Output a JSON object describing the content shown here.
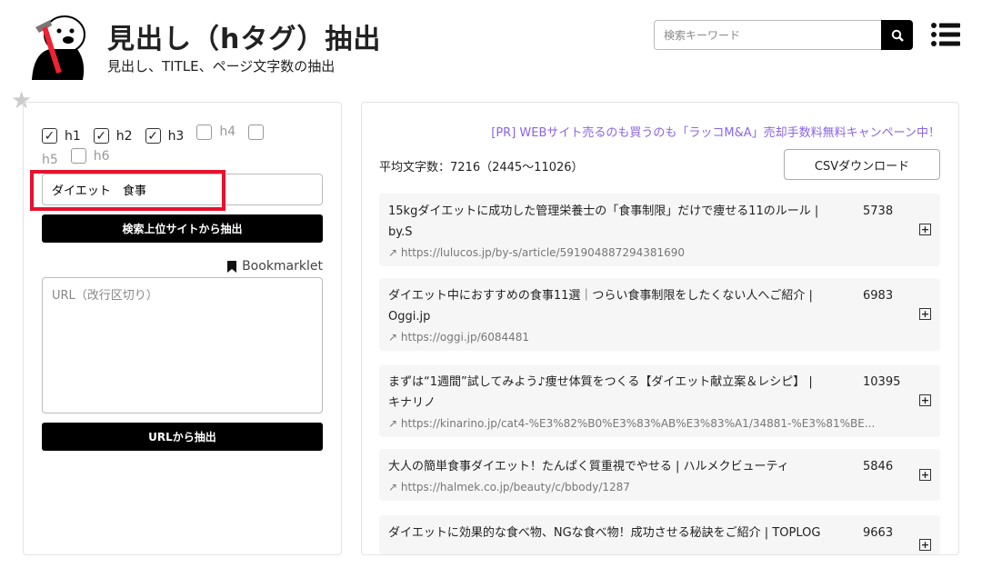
{
  "header": {
    "title": "見出し（hタグ）抽出",
    "subtitle": "見出し、TITLE、ページ文字数の抽出",
    "search_placeholder": "検索キーワード"
  },
  "left": {
    "checkboxes": [
      {
        "label": "h1",
        "checked": true
      },
      {
        "label": "h2",
        "checked": true
      },
      {
        "label": "h3",
        "checked": true
      },
      {
        "label": "h4",
        "checked": false
      },
      {
        "label": "h5",
        "checked": false
      },
      {
        "label": "h6",
        "checked": false
      }
    ],
    "keyword": "ダイエット　食事",
    "extract_search_label": "検索上位サイトから抽出",
    "bookmarklet_label": "Bookmarklet",
    "url_placeholder": "URL（改行区切り）",
    "extract_url_label": "URLから抽出"
  },
  "right": {
    "pr": "[PR] WEBサイト売るのも買うのも「ラッコM&A」売却手数料無料キャンペーン中！",
    "average": "平均文字数：7216（2445〜11026）",
    "csv_label": "CSVダウンロード",
    "results": [
      {
        "title": "15kgダイエットに成功した管理栄養士の「食事制限」だけで痩せる11のルール | by.S",
        "count": "5738",
        "url": "https://lulucos.jp/by-s/article/591904887294381690"
      },
      {
        "title": "ダイエット中におすすめの食事11選｜つらい食事制限をしたくない人へご紹介 | Oggi.jp",
        "count": "6983",
        "url": "https://oggi.jp/6084481"
      },
      {
        "title": "まずは“1週間”試してみよう♪痩せ体質をつくる【ダイエット献立案＆レシピ】 | キナリノ",
        "count": "10395",
        "url": "https://kinarino.jp/cat4-%E3%82%B0%E3%83%AB%E3%83%A1/34881-%E3%81%BE..."
      },
      {
        "title": "大人の簡単食事ダイエット！たんぱく質重視でやせる | ハルメクビューティ",
        "count": "5846",
        "url": "https://halmek.co.jp/beauty/c/bbody/1287"
      },
      {
        "title": "ダイエットに効果的な食べ物、NGな食べ物！成功させる秘訣をご紹介 | TOPLOG",
        "count": "9663",
        "url": ""
      }
    ]
  }
}
